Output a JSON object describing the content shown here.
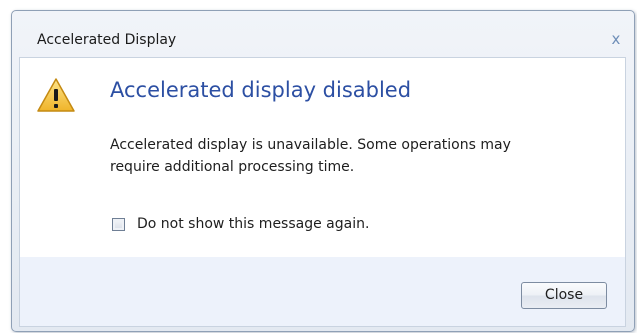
{
  "window": {
    "title": "Accelerated Display",
    "close_glyph": "x"
  },
  "content": {
    "icon": "warning-icon",
    "heading": "Accelerated display disabled",
    "message_line1": "Accelerated display is unavailable. Some operations may",
    "message_line2": "require additional processing time.",
    "checkbox": {
      "label": "Do not show this message again.",
      "checked": false
    }
  },
  "footer": {
    "close_label": "Close"
  },
  "colors": {
    "heading": "#2c4fa3",
    "warning_fill": "#f6c746",
    "footer_bg": "#edf2fb"
  }
}
